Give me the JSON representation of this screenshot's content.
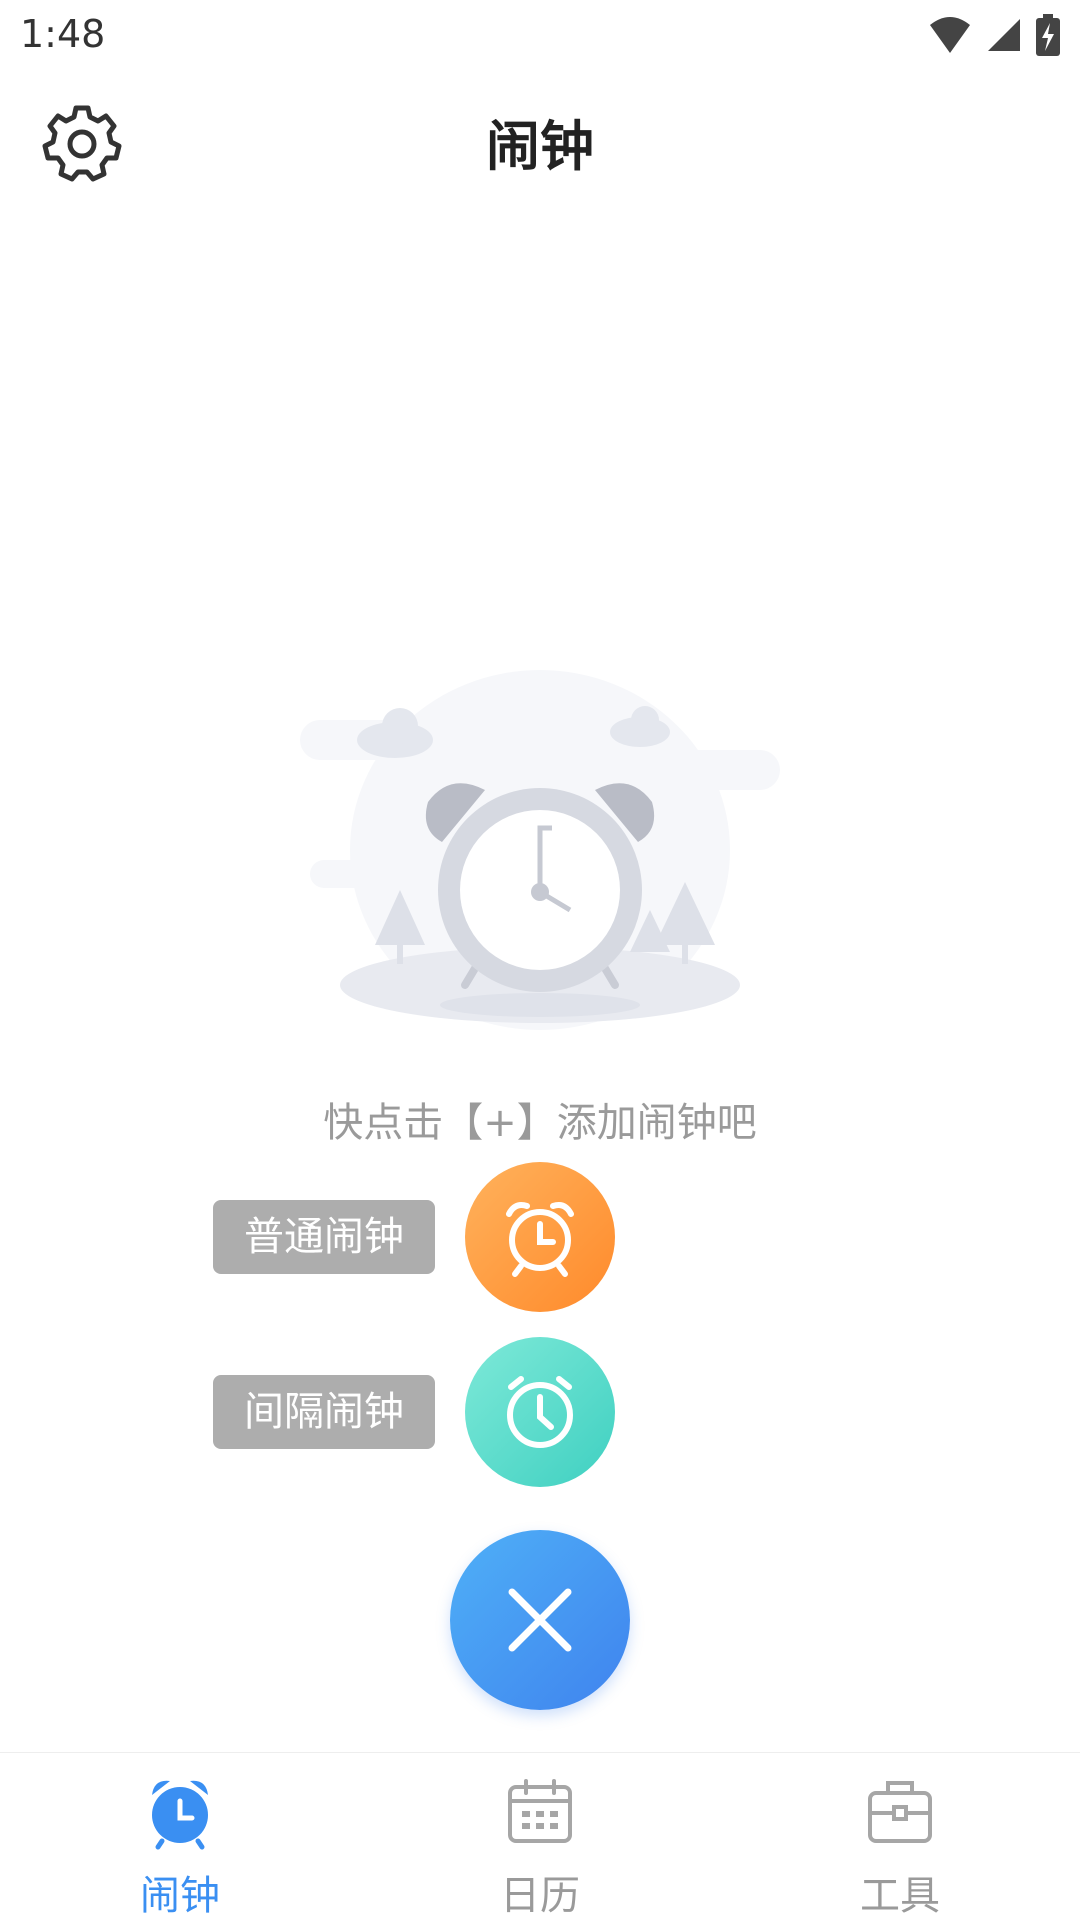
{
  "status": {
    "time": "1:48"
  },
  "header": {
    "title": "闹钟"
  },
  "empty_state": {
    "hint": "快点击【+】添加闹钟吧"
  },
  "fab_menu": {
    "items": [
      {
        "label": "普通闹钟",
        "color": "#ff9a3d"
      },
      {
        "label": "间隔闹钟",
        "color": "#4fd8c8"
      }
    ],
    "close_color": "#3f8cf0"
  },
  "bottom_nav": {
    "items": [
      {
        "label": "闹钟",
        "icon": "alarm-icon",
        "active": true
      },
      {
        "label": "日历",
        "icon": "calendar-icon",
        "active": false
      },
      {
        "label": "工具",
        "icon": "toolbox-icon",
        "active": false
      }
    ],
    "active_color": "#3a8ff2",
    "inactive_color": "#9a9a9a"
  }
}
